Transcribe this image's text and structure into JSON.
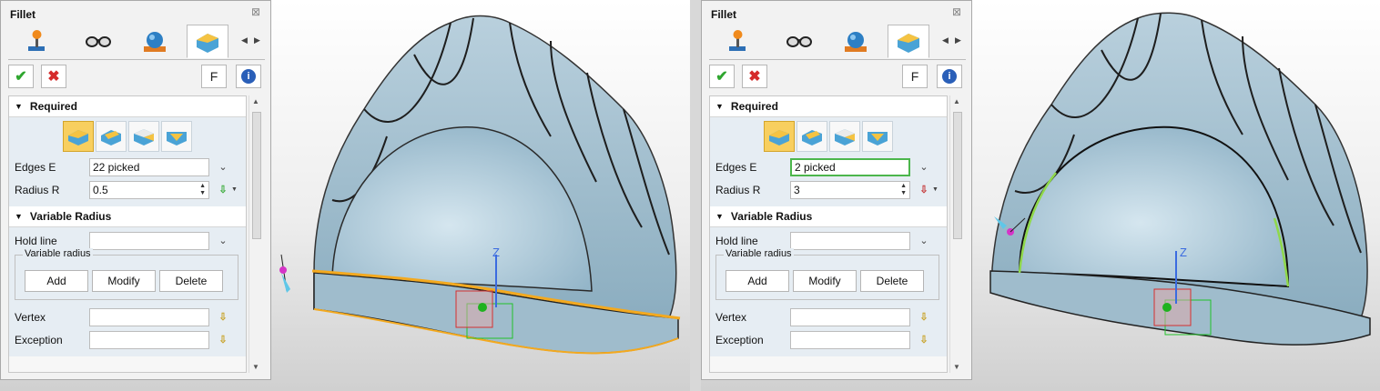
{
  "panels": [
    {
      "title": "Fillet",
      "tabs": [
        "joystick",
        "glasses",
        "ball-base",
        "fillet-cube"
      ],
      "toolbar": {
        "f_label": "F"
      },
      "required": {
        "header": "Required",
        "edges_label": "Edges E",
        "edges_value": "22 picked",
        "radius_label": "Radius R",
        "radius_value": "0.5"
      },
      "variable": {
        "header": "Variable Radius",
        "hold_line_label": "Hold line",
        "hold_line_value": "",
        "group_label": "Variable radius",
        "add_label": "Add",
        "modify_label": "Modify",
        "delete_label": "Delete",
        "vertex_label": "Vertex",
        "exception_label": "Exception"
      }
    },
    {
      "title": "Fillet",
      "tabs": [
        "joystick",
        "glasses",
        "ball-base",
        "fillet-cube"
      ],
      "toolbar": {
        "f_label": "F"
      },
      "required": {
        "header": "Required",
        "edges_label": "Edges E",
        "edges_value": "2 picked",
        "radius_label": "Radius R",
        "radius_value": "3"
      },
      "variable": {
        "header": "Variable Radius",
        "hold_line_label": "Hold line",
        "hold_line_value": "",
        "group_label": "Variable radius",
        "add_label": "Add",
        "modify_label": "Modify",
        "delete_label": "Delete",
        "vertex_label": "Vertex",
        "exception_label": "Exception"
      }
    }
  ],
  "viewport": {
    "axis_label": "Z"
  },
  "colors": {
    "model_fill": "#a9c4d3",
    "selected_edge": "#f3a91f",
    "edge_green": "#8fd84a",
    "accent_selected": "#f8cf5f"
  }
}
